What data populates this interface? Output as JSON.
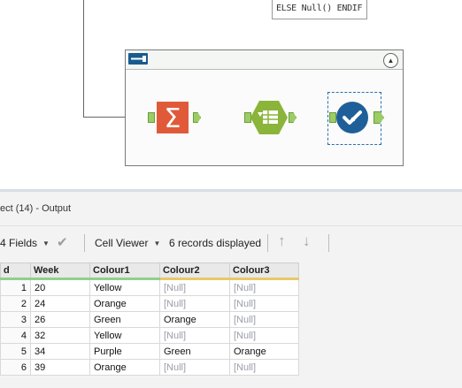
{
  "canvas": {
    "formula_snippet": "ELSE Null() ENDIF",
    "container": {
      "collapse_glyph": "▲"
    },
    "tools": [
      {
        "name": "summarize-tool",
        "color": "#e05a3a"
      },
      {
        "name": "crosstab-tool",
        "color": "#8bb43a"
      },
      {
        "name": "select-tool",
        "color": "#1e5f99"
      }
    ]
  },
  "results": {
    "title": "ect (14) - Output",
    "toolbar": {
      "fields_label": "4 Fields",
      "viewer_label": "Cell Viewer",
      "records_label": "6 records displayed"
    },
    "grid": {
      "headers": [
        "d",
        "Week",
        "Colour1",
        "Colour2",
        "Colour3"
      ],
      "rows": [
        [
          "1",
          "20",
          "Yellow",
          "[Null]",
          "[Null]"
        ],
        [
          "2",
          "24",
          "Orange",
          "[Null]",
          "[Null]"
        ],
        [
          "3",
          "26",
          "Green",
          "Orange",
          "[Null]"
        ],
        [
          "4",
          "32",
          "Yellow",
          "[Null]",
          "[Null]"
        ],
        [
          "5",
          "34",
          "Purple",
          "Green",
          "Orange"
        ],
        [
          "6",
          "39",
          "Orange",
          "[Null]",
          "[Null]"
        ]
      ]
    }
  }
}
